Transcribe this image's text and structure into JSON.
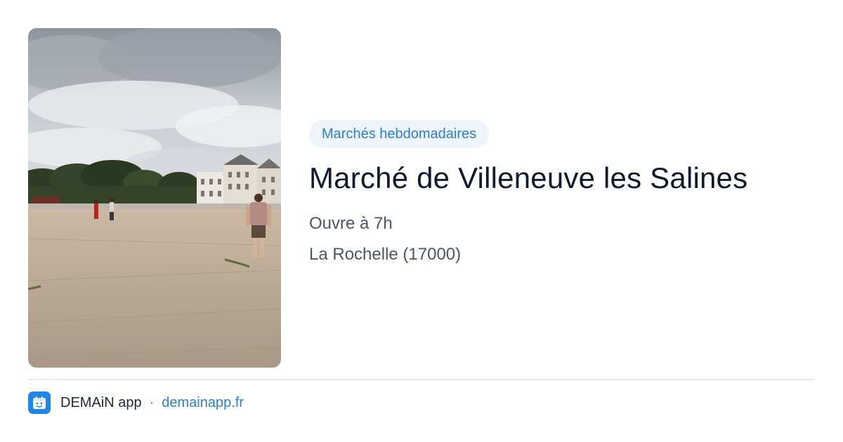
{
  "card": {
    "photo_alt": "",
    "category": "Marchés hebdomadaires",
    "title": "Marché de Villeneuve les Salines",
    "hours": "Ouvre à 7h",
    "location": "La Rochelle (17000)"
  },
  "footer": {
    "app_name": "DEMAiN app",
    "separator": "·",
    "site": "demainapp.fr",
    "logo_icon": "calendar-face-icon"
  },
  "colors": {
    "accent": "#2f7dd8",
    "pill_bg": "#eef4fc",
    "title": "#0f1a2e",
    "meta": "#4b5563",
    "logo_bg": "#1e86e8"
  }
}
